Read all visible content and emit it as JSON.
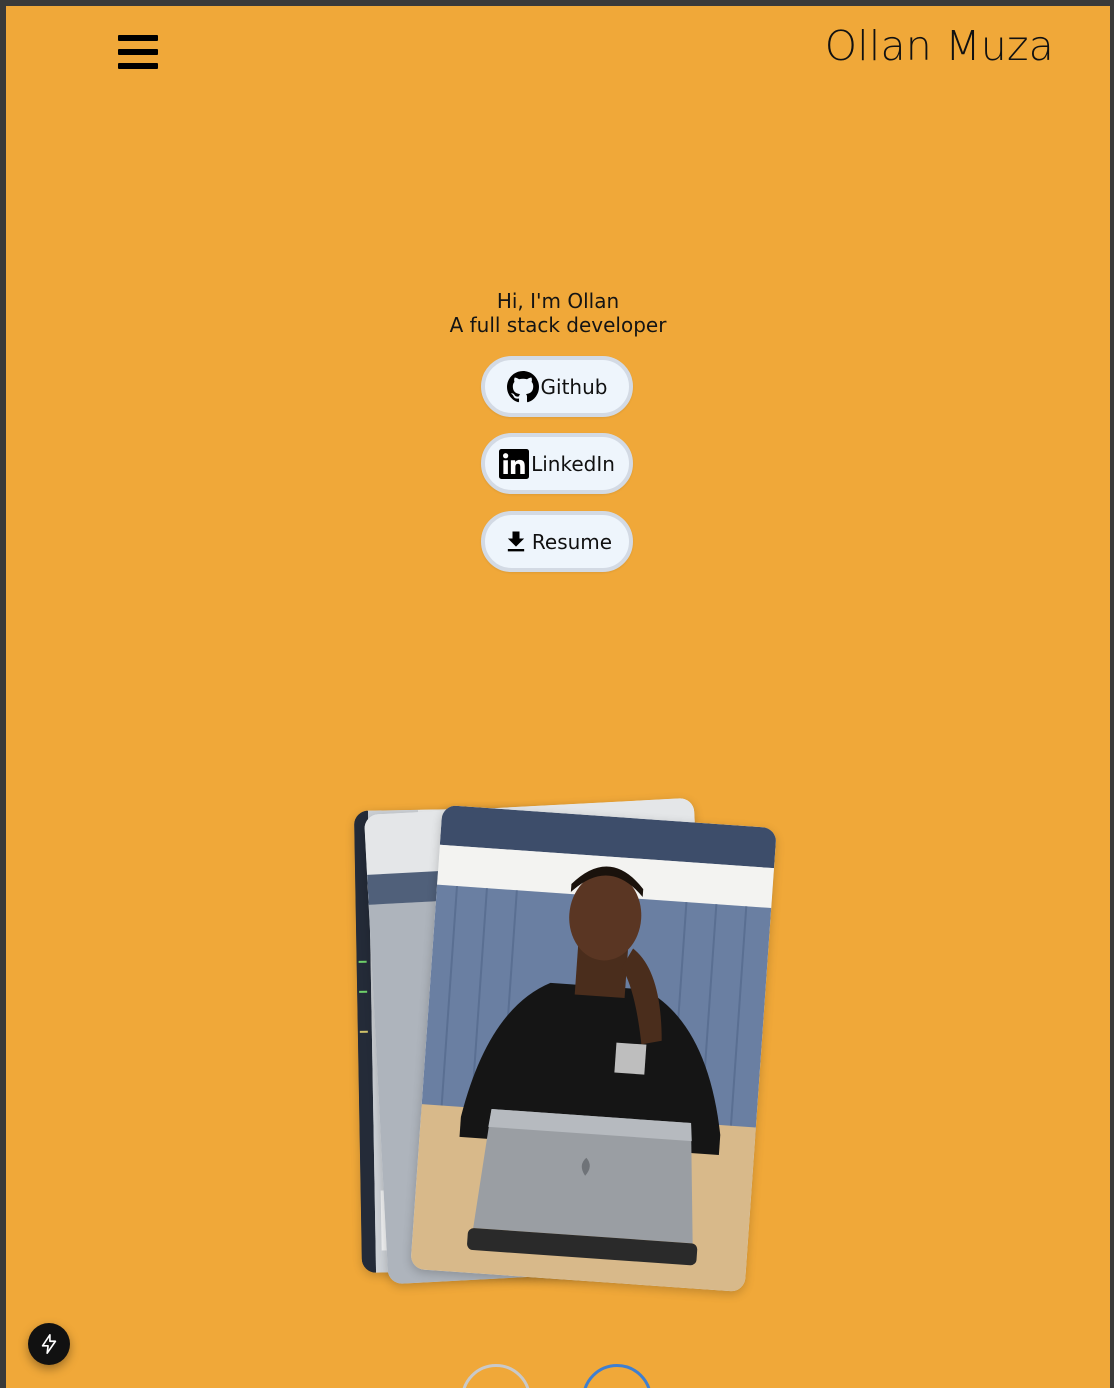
{
  "header": {
    "title": "Ollan Muza",
    "menu_icon": "hamburger-icon"
  },
  "hero": {
    "greeting": "Hi, I'm Ollan",
    "tagline": "A full stack developer"
  },
  "buttons": {
    "github": {
      "label": "Github",
      "icon": "github-icon"
    },
    "linkedin": {
      "label": "LinkedIn",
      "icon": "linkedin-icon"
    },
    "resume": {
      "label": "Resume",
      "icon": "download-icon"
    }
  },
  "gallery": {
    "photo_count": 3
  },
  "colors": {
    "background": "#f0a839",
    "button_bg": "#eef5fc",
    "button_border": "#d3dae4",
    "active_dot": "#3f7fd0"
  },
  "fab": {
    "icon": "lightning-icon"
  }
}
